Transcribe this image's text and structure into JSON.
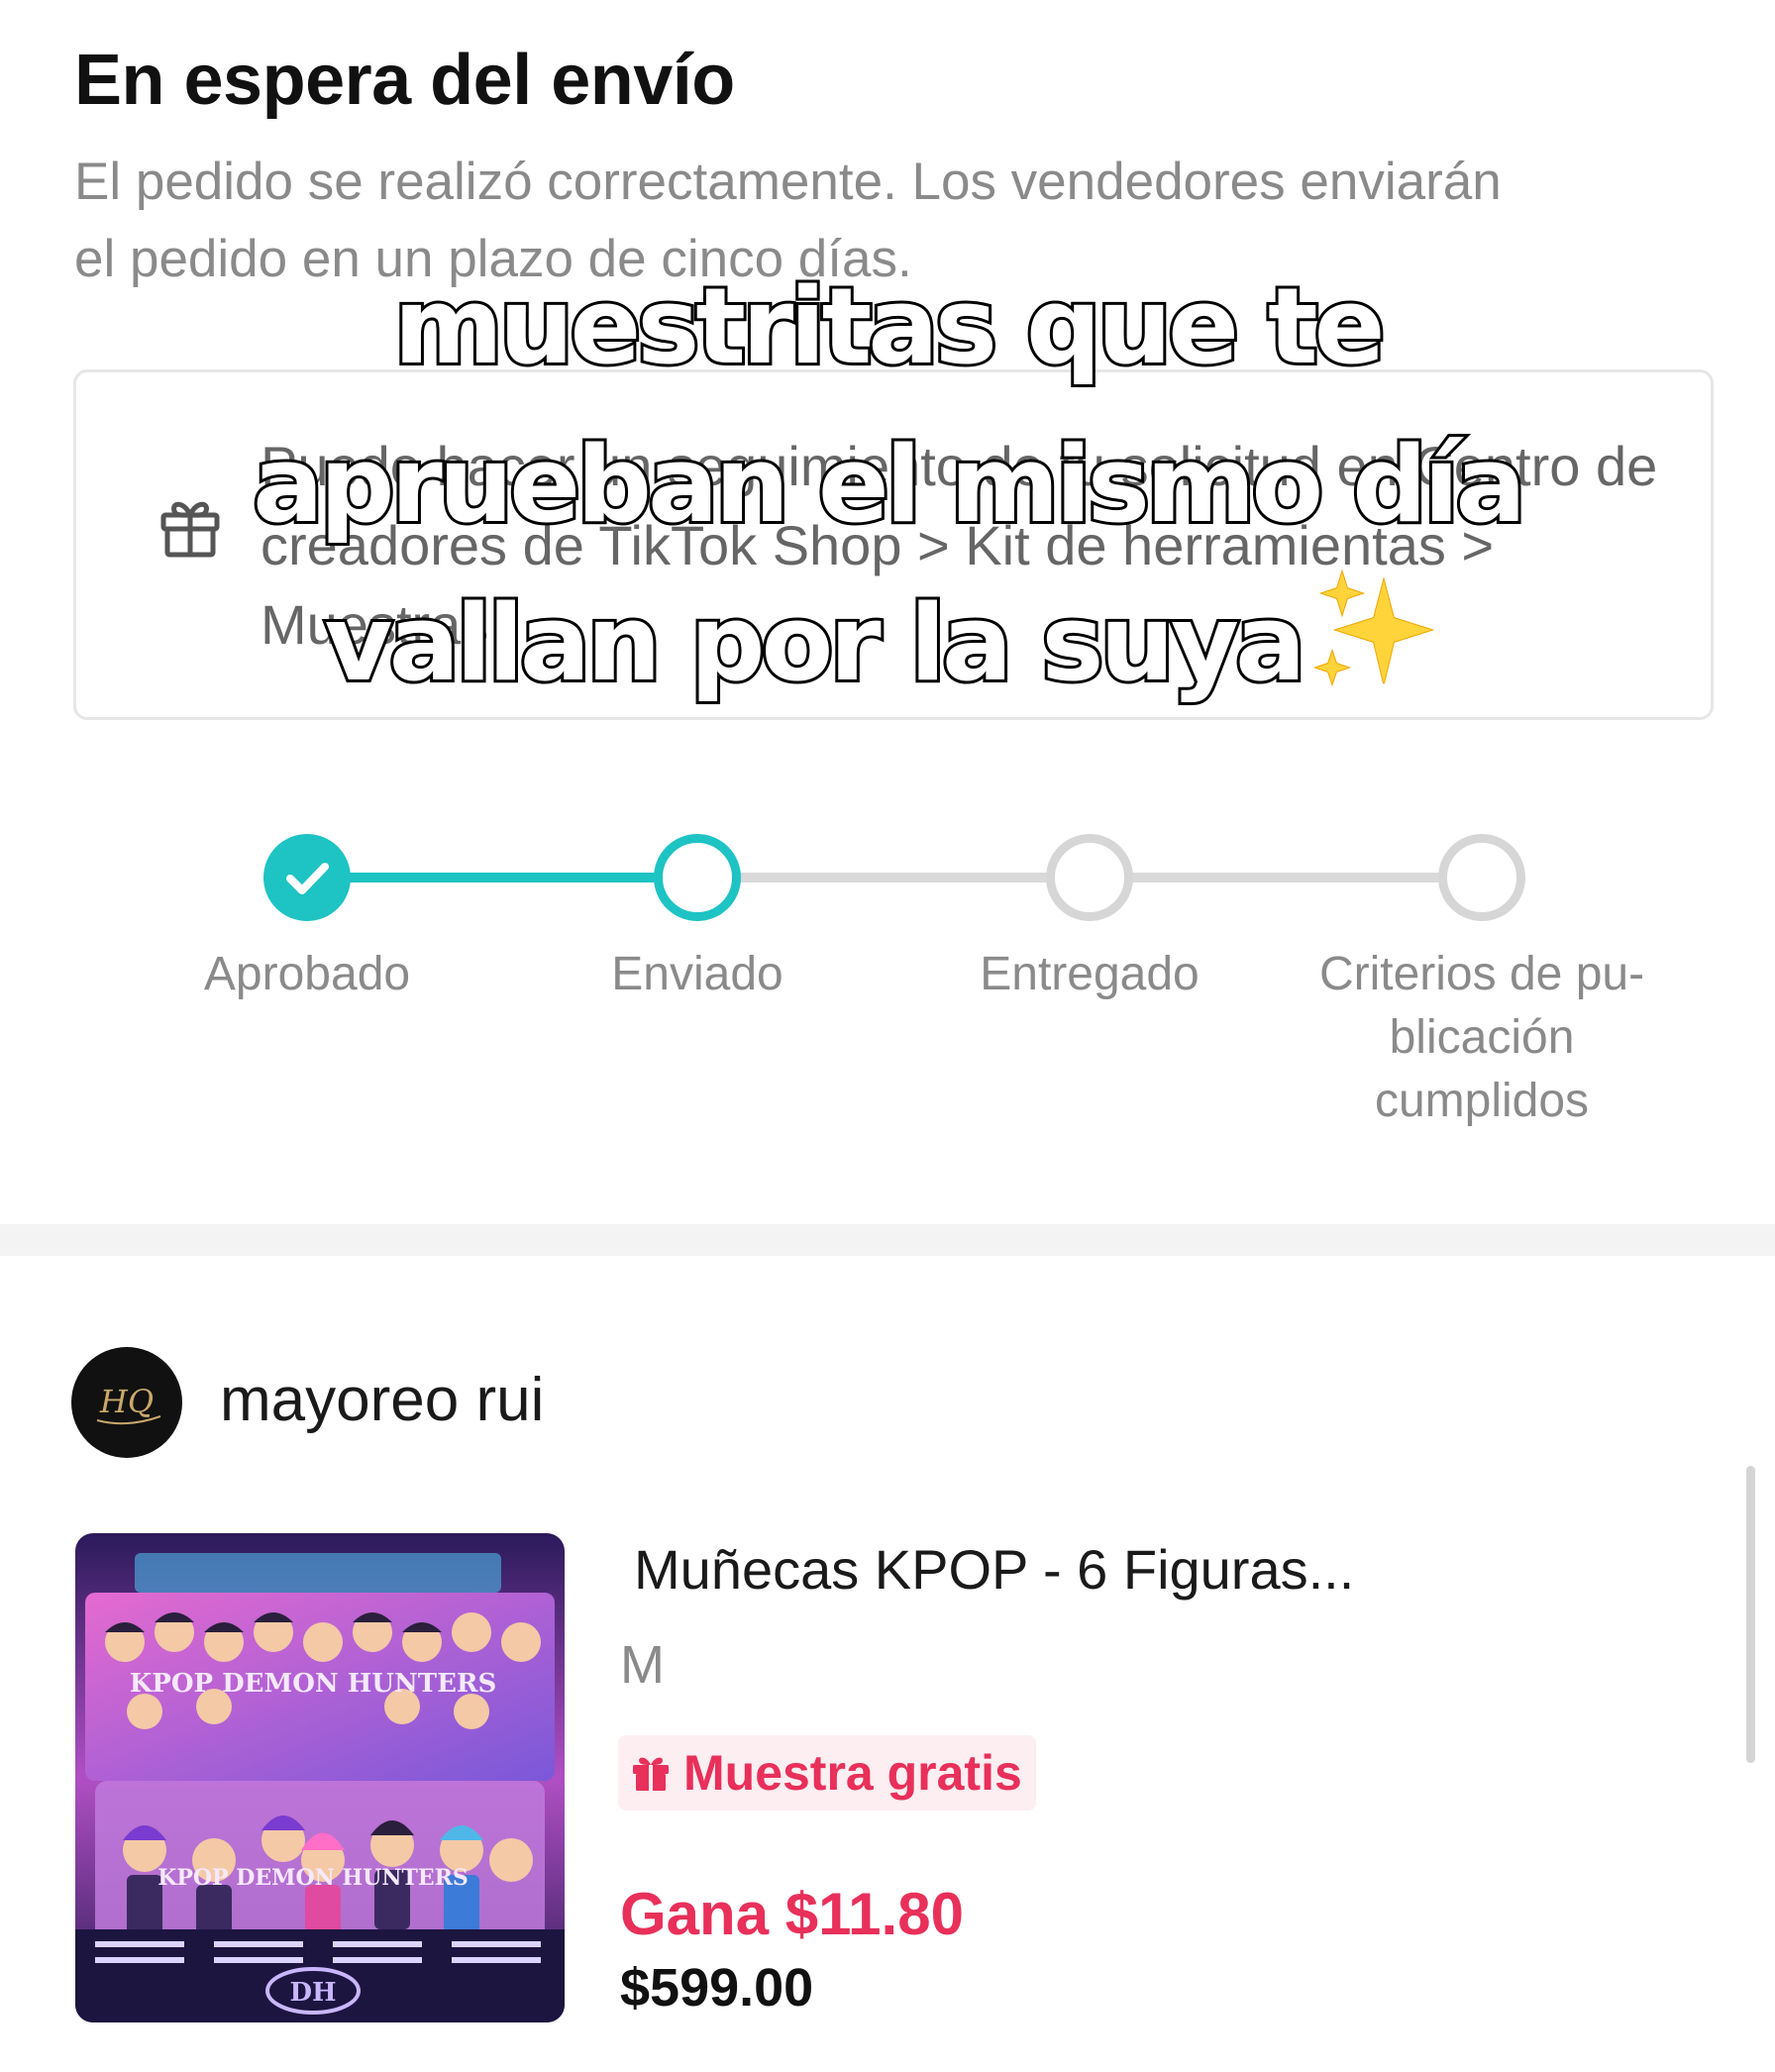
{
  "status": {
    "title": "En espera del envío",
    "description": "El pedido se realizó correctamente. Los vendedores enviarán el pedido en un plazo de cinco días."
  },
  "info_box": {
    "icon": "gift-icon",
    "text": "Puede hacer un seguimiento de tu solicitud en Centro de creadores de TikTok Shop > Kit de herramientas > Muestras"
  },
  "overlay": {
    "line1": "muestritas que te",
    "line2": "aprueban el mismo día",
    "line3": "vallan por la suya",
    "emoji": "sparkles-icon"
  },
  "progress": {
    "steps": [
      {
        "label": "Aprobado",
        "state": "done"
      },
      {
        "label": "Enviado",
        "state": "current"
      },
      {
        "label": "Entregado",
        "state": "pending"
      },
      {
        "label": "Criterios de pu-blicación cumplidos",
        "state": "pending"
      }
    ],
    "accent_color": "#1ec3c4",
    "pending_color": "#d6d6d6"
  },
  "seller": {
    "avatar_text": "HQ",
    "name": "mayoreo rui"
  },
  "product": {
    "image_label_1": "KPOP DEMON HUNTERS",
    "image_label_2": "KPOP DEMON HUNTERS",
    "image_label_3": "DH",
    "title": "Muñecas KPOP - 6 Figuras...",
    "variant": "M",
    "badge": "Muestra gratis",
    "earn": "Gana $11.80",
    "price": "$599.00",
    "accent_color": "#e8305a"
  }
}
